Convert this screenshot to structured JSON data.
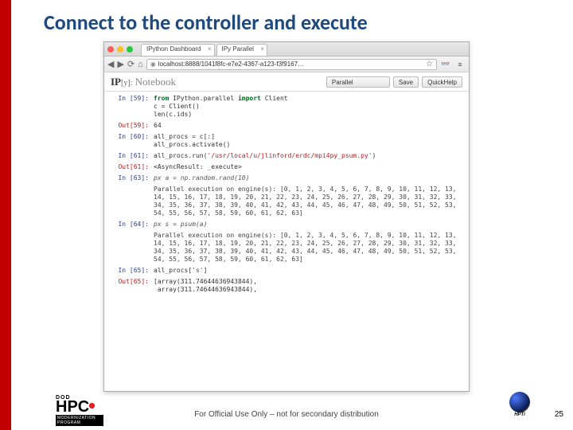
{
  "slide": {
    "title": "Connect to the controller and execute",
    "footer": "For Official Use Only – not for secondary distribution",
    "page": "25"
  },
  "browser": {
    "tabs": [
      {
        "label": "IPython Dashboard"
      },
      {
        "label": "IPy Parallel"
      }
    ],
    "url": "localhost:8888/1041f8fc-e7e2-4367-a123-f3f9167…"
  },
  "notebook": {
    "brand_ip": "IP",
    "brand_y": "[y]:",
    "brand_nb": "Notebook",
    "buttons": {
      "name": "Parallel",
      "save": "Save",
      "quick": "QuickHelp"
    }
  },
  "cells": [
    {
      "type": "in",
      "n": "59",
      "lines": [
        "from IPython.parallel import Client",
        "c = Client()",
        "len(c.ids)"
      ]
    },
    {
      "type": "out",
      "n": "59",
      "lines": [
        "64"
      ]
    },
    {
      "type": "in",
      "n": "60",
      "lines": [
        "all_procs = c[:]",
        "all_procs.activate()"
      ]
    },
    {
      "type": "in",
      "n": "61",
      "lines": [
        "all_procs.run('/usr/local/u/jlinford/erdc/mpi4py_psum.py')"
      ]
    },
    {
      "type": "out",
      "n": "61",
      "lines": [
        "<AsyncResult: _execute>"
      ]
    },
    {
      "type": "in",
      "n": "63",
      "lines": [
        "px a = np.random.rand(10)"
      ]
    },
    {
      "type": "stream",
      "lines": [
        "Parallel execution on engine(s): [0, 1, 2, 3, 4, 5, 6, 7, 8, 9, 10, 11, 12, 13, 14, 15, 16, 17, 18, 19, 20, 21, 22, 23, 24, 25, 26, 27, 28, 29, 30, 31, 32, 33, 34, 35, 36, 37, 38, 39, 40, 41, 42, 43, 44, 45, 46, 47, 48, 49, 50, 51, 52, 53, 54, 55, 56, 57, 58, 59, 60, 61, 62, 63]"
      ]
    },
    {
      "type": "in",
      "n": "64",
      "lines": [
        "px s = psum(a)"
      ]
    },
    {
      "type": "stream",
      "lines": [
        "Parallel execution on engine(s): [0, 1, 2, 3, 4, 5, 6, 7, 8, 9, 10, 11, 12, 13, 14, 15, 16, 17, 18, 19, 20, 21, 22, 23, 24, 25, 26, 27, 28, 29, 30, 31, 32, 33, 34, 35, 36, 37, 38, 39, 40, 41, 42, 43, 44, 45, 46, 47, 48, 49, 50, 51, 52, 53, 54, 55, 56, 57, 58, 59, 60, 61, 62, 63]"
      ]
    },
    {
      "type": "in",
      "n": "65",
      "lines": [
        "all_procs['s']"
      ]
    },
    {
      "type": "out",
      "n": "65",
      "lines": [
        "[array(311.74644636943844),",
        " array(311.74644636943844),"
      ]
    }
  ],
  "logos": {
    "dod": "DOD",
    "hpc": "HPC",
    "modern": "MODERNIZATION PROGRAM",
    "hpti": "HPTi"
  }
}
